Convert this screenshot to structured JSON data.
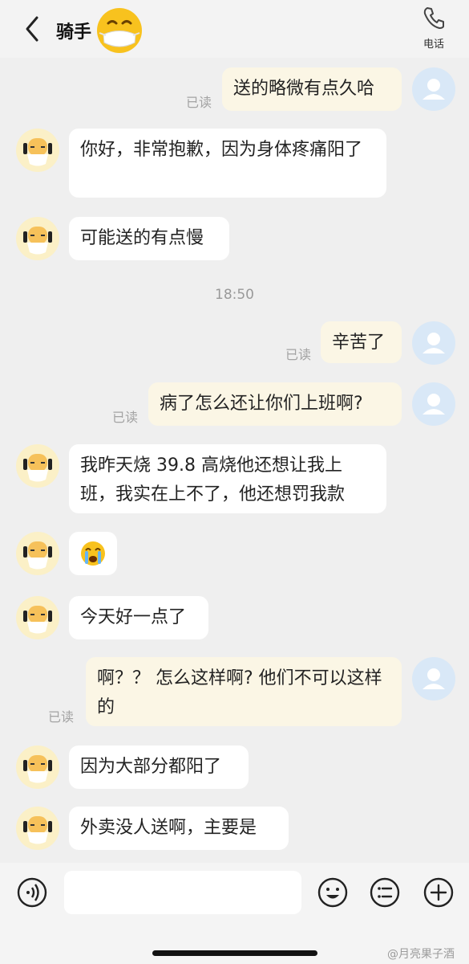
{
  "header": {
    "title": "骑手",
    "phone_label": "电话"
  },
  "messages": [
    {
      "side": "mine",
      "text": "送的略微有点久哈",
      "read": "已读"
    },
    {
      "side": "theirs",
      "text": "你好，非常抱歉，因为身体疼痛阳了"
    },
    {
      "side": "theirs",
      "text": "可能送的有点慢"
    },
    {
      "type": "time",
      "text": "18:50"
    },
    {
      "side": "mine",
      "text": "辛苦了",
      "read": "已读"
    },
    {
      "side": "mine",
      "text": "病了怎么还让你们上班啊?",
      "read": "已读"
    },
    {
      "side": "theirs",
      "text": "我昨天烧 39.8 高烧他还想让我上班，我实在上不了，他还想罚我款"
    },
    {
      "side": "theirs",
      "emoji": "loudly-crying-face"
    },
    {
      "side": "theirs",
      "text": "今天好一点了"
    },
    {
      "side": "mine",
      "text": "啊？？ 怎么这样啊? 他们不可以这样的",
      "read": "已读"
    },
    {
      "side": "theirs",
      "text": "因为大部分都阳了"
    },
    {
      "side": "theirs",
      "text": "外卖没人送啊，主要是"
    }
  ],
  "watermark": "@月亮果子酒",
  "icons": {
    "back": "back-arrow-icon",
    "title_emoji": "mask-face-emoji-icon",
    "phone": "phone-icon",
    "voice": "voice-input-icon",
    "emoji": "emoji-icon",
    "more": "more-options-icon",
    "add": "add-icon"
  },
  "colors": {
    "background": "#efefef",
    "my_bubble": "#fbf6e5",
    "their_bubble": "#ffffff",
    "user_avatar": "#d9e8f7",
    "rider_avatar": "#fbf0c7"
  }
}
